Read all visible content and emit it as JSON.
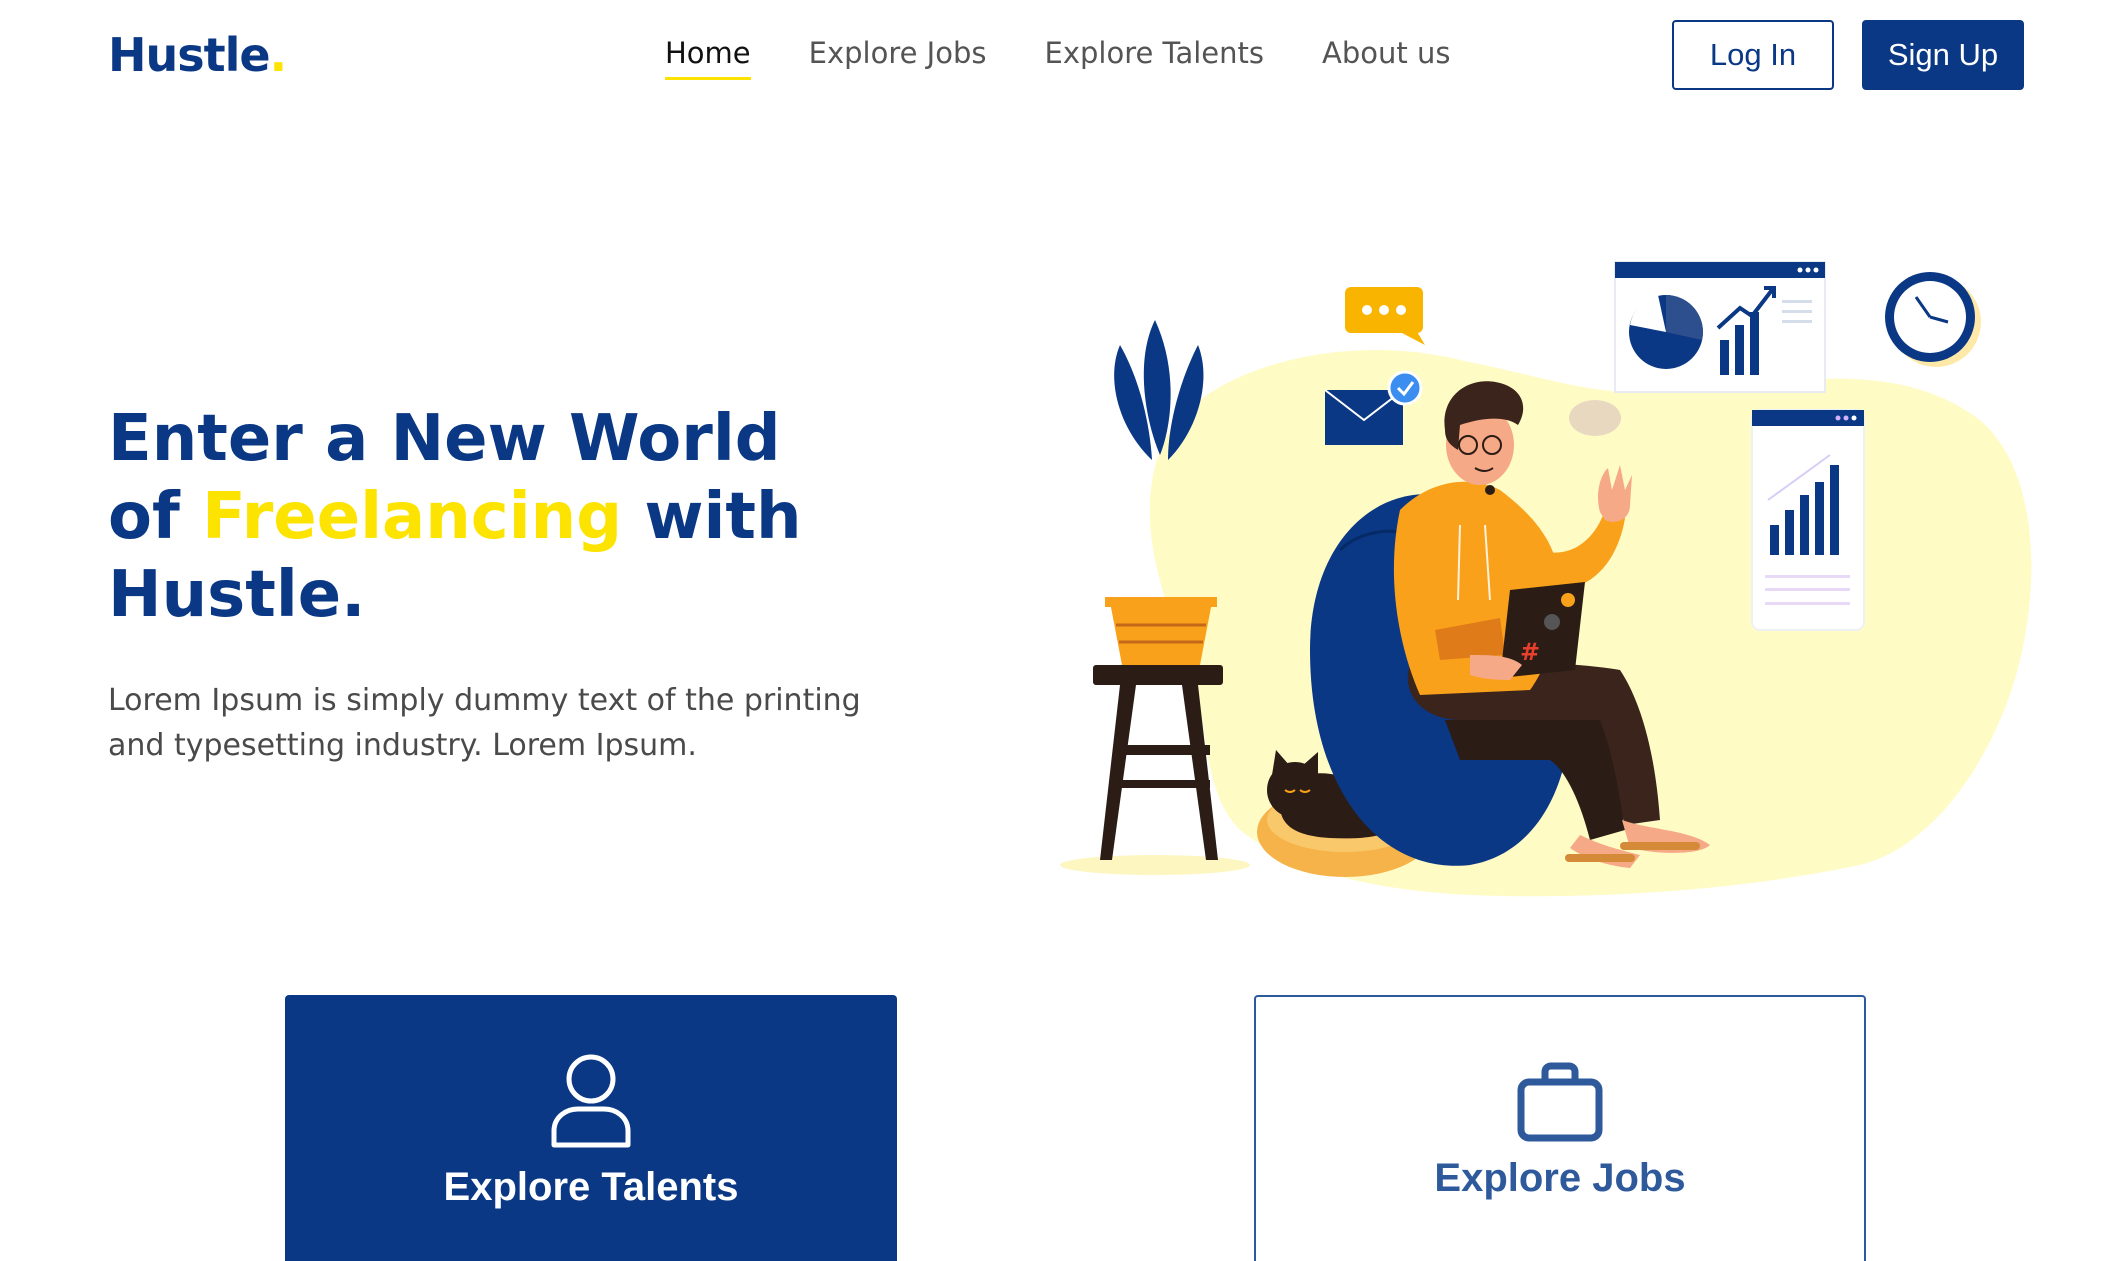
{
  "brand": {
    "name": "Hustle",
    "dot": "."
  },
  "nav": {
    "items": [
      {
        "label": "Home",
        "active": true
      },
      {
        "label": "Explore Jobs",
        "active": false
      },
      {
        "label": "Explore Talents",
        "active": false
      },
      {
        "label": "About us",
        "active": false
      }
    ]
  },
  "auth": {
    "login_label": "Log In",
    "signup_label": "Sign Up"
  },
  "hero": {
    "title_line1": "Enter a New World",
    "title_of": "of",
    "title_highlight": "Freelancing",
    "title_with": "with",
    "title_brand": "Hustle.",
    "description": "Lorem Ipsum is simply dummy text of the printing and typesetting industry. Lorem Ipsum.",
    "illustration_hashtag": "#"
  },
  "cards": {
    "talents": {
      "label": "Explore Talents",
      "icon": "user-icon"
    },
    "jobs": {
      "label": "Explore Jobs",
      "icon": "briefcase-icon"
    }
  },
  "colors": {
    "primary": "#0a3885",
    "accent": "#fce300",
    "orange": "#f9a11b",
    "text": "#4a4a4a"
  }
}
